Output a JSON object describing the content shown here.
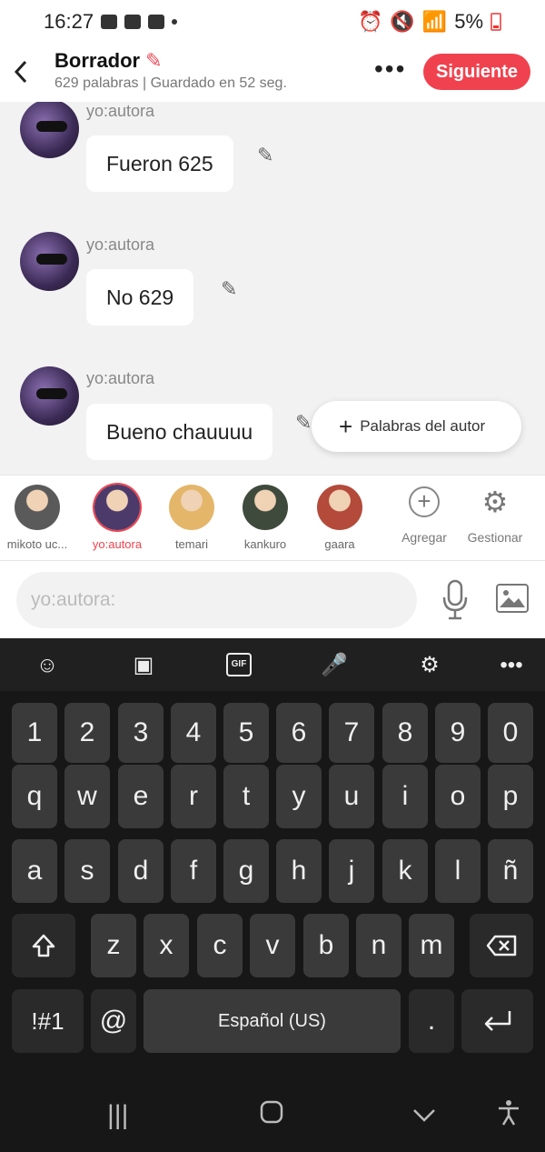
{
  "status_bar": {
    "time": "16:27",
    "battery": "5%"
  },
  "header": {
    "title": "Borrador",
    "subtitle": "629 palabras | Guardado en 52 seg.",
    "more_label": "•••",
    "next_label": "Siguiente"
  },
  "messages": [
    {
      "author": "yo:autora",
      "text": "Fueron 625"
    },
    {
      "author": "yo:autora",
      "text": "No 629"
    },
    {
      "author": "yo:autora",
      "text": "Bueno chauuuu"
    }
  ],
  "fab": {
    "label": "Palabras del autor"
  },
  "characters": [
    {
      "name": "mikoto uc...",
      "color": "#5a5a5a"
    },
    {
      "name": "yo:autora",
      "color": "#4b3a6a"
    },
    {
      "name": "temari",
      "color": "#e3b66a"
    },
    {
      "name": "kankuro",
      "color": "#3e4a3b"
    },
    {
      "name": "gaara",
      "color": "#b34a3a"
    }
  ],
  "tools": {
    "add_label": "Agregar",
    "manage_label": "Gestionar"
  },
  "composer": {
    "placeholder": "yo:autora:"
  },
  "keyboard": {
    "gif_label": "GIF",
    "rows": [
      [
        "1",
        "2",
        "3",
        "4",
        "5",
        "6",
        "7",
        "8",
        "9",
        "0"
      ],
      [
        "q",
        "w",
        "e",
        "r",
        "t",
        "y",
        "u",
        "i",
        "o",
        "p"
      ],
      [
        "a",
        "s",
        "d",
        "f",
        "g",
        "h",
        "j",
        "k",
        "l",
        "ñ"
      ],
      [
        "z",
        "x",
        "c",
        "v",
        "b",
        "n",
        "m"
      ]
    ],
    "symbols_label": "!#1",
    "at_label": "@",
    "space_label": "Español (US)",
    "period_label": "."
  },
  "colors": {
    "accent": "#f0424e",
    "chat_bg": "#f2f2f2",
    "keyboard_bg": "#171717"
  }
}
